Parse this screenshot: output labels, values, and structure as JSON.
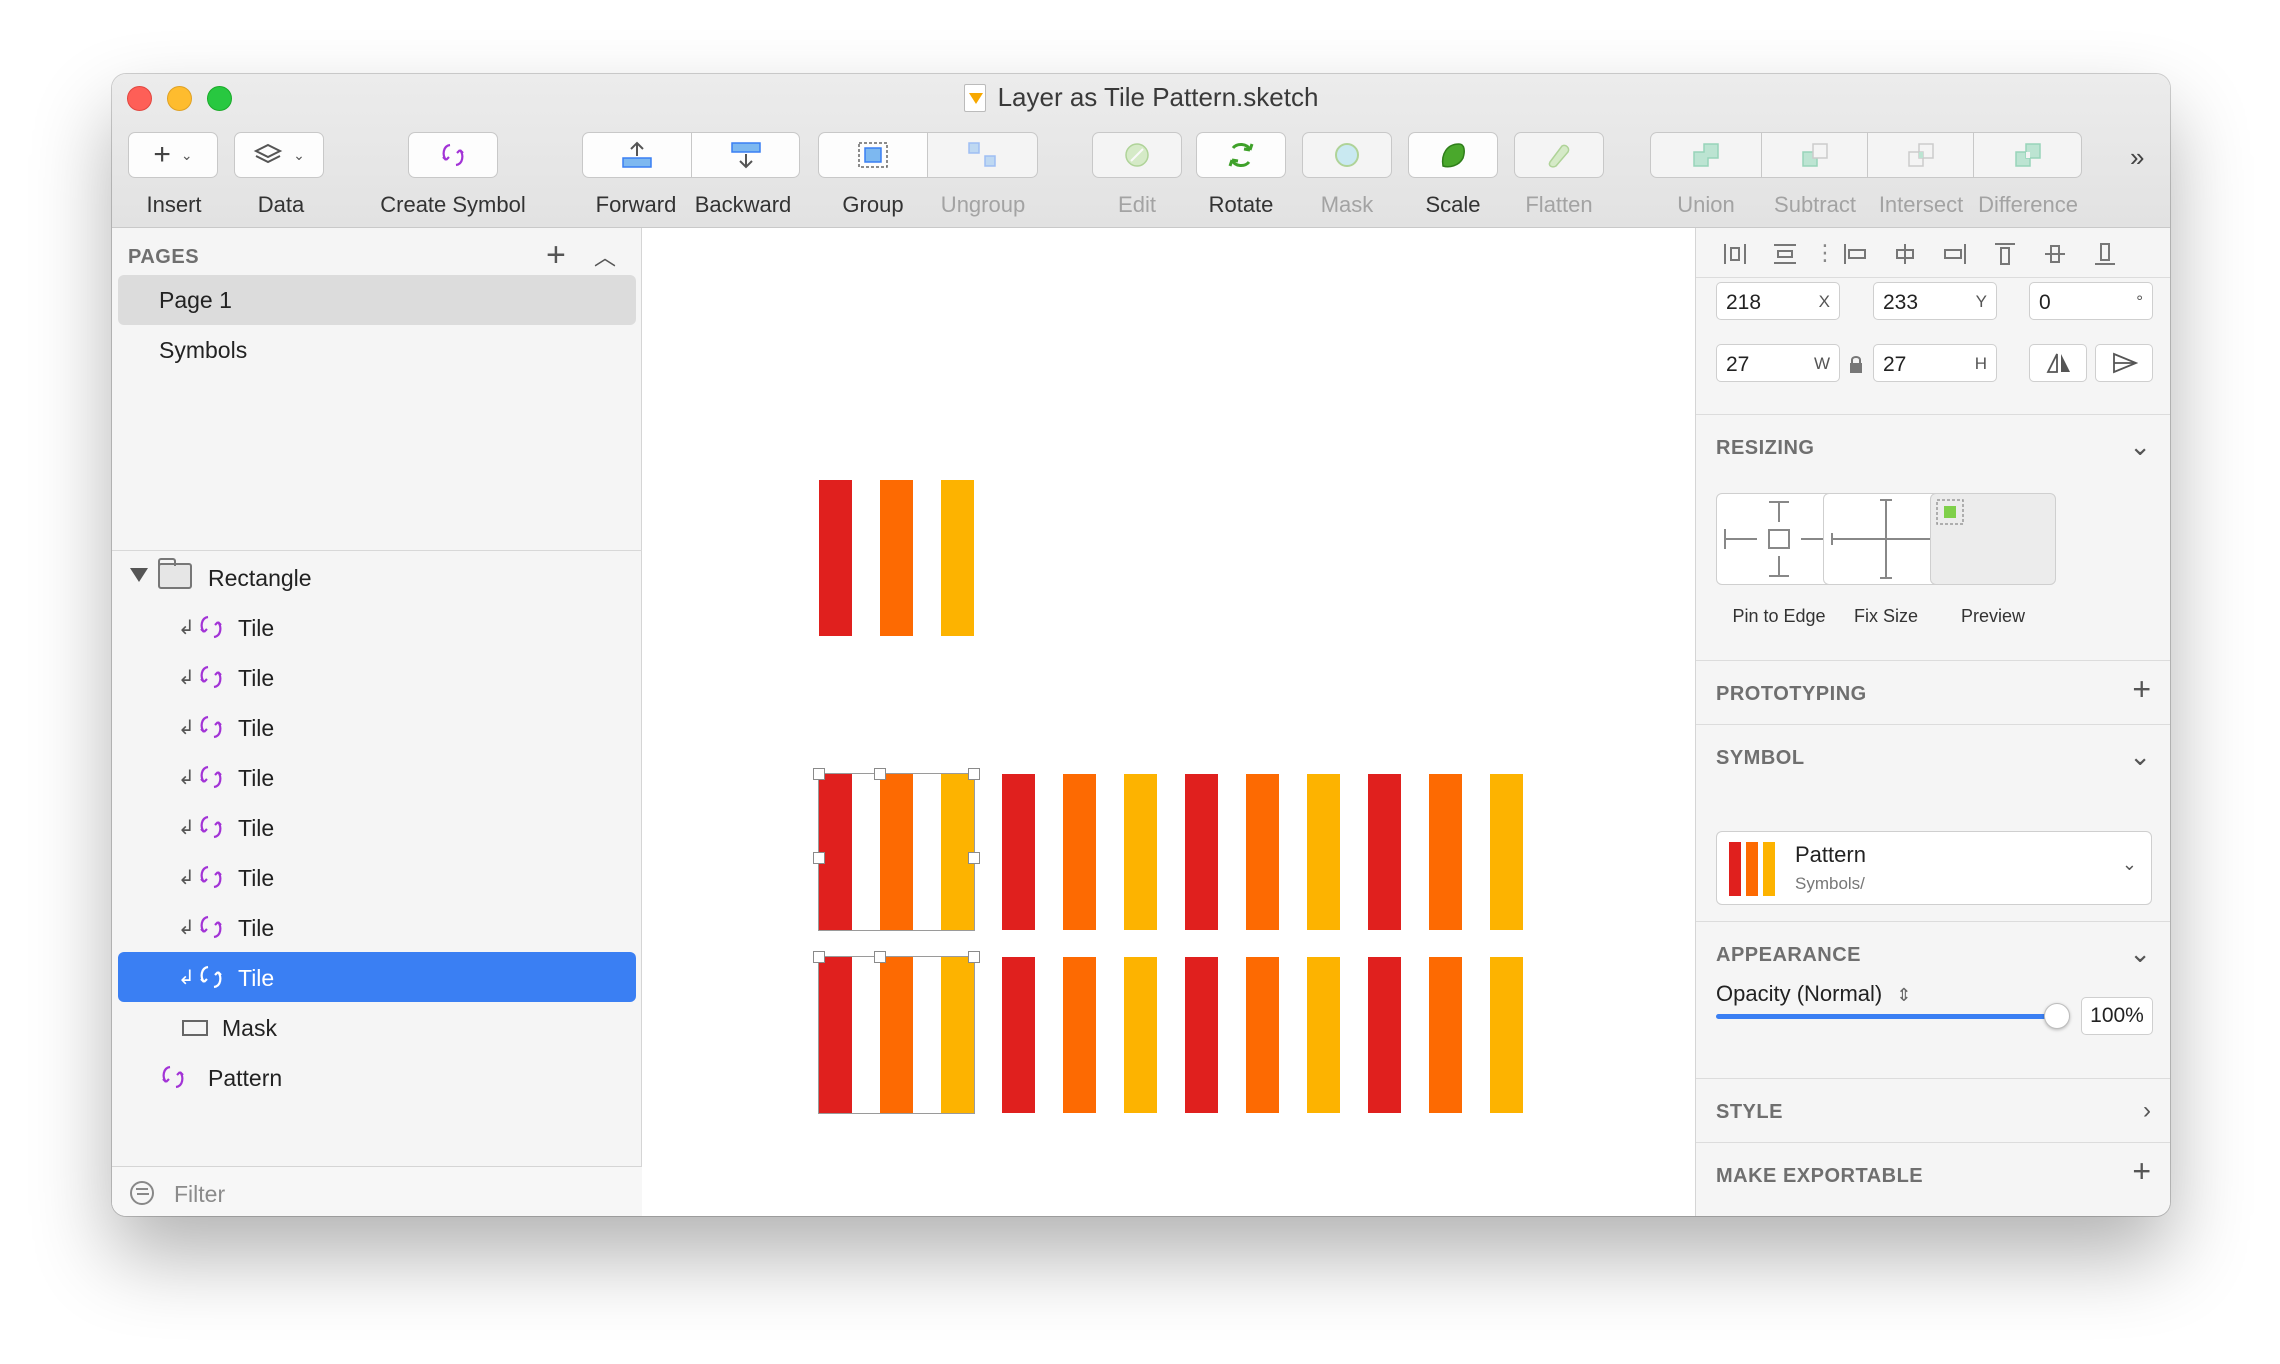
{
  "window": {
    "title": "Layer as Tile Pattern.sketch"
  },
  "toolbar": {
    "insert": "Insert",
    "data": "Data",
    "create_symbol": "Create Symbol",
    "forward": "Forward",
    "backward": "Backward",
    "group": "Group",
    "ungroup": "Ungroup",
    "edit": "Edit",
    "rotate": "Rotate",
    "mask": "Mask",
    "scale": "Scale",
    "flatten": "Flatten",
    "union": "Union",
    "subtract": "Subtract",
    "intersect": "Intersect",
    "difference": "Difference"
  },
  "pages": {
    "title": "PAGES",
    "items": [
      {
        "label": "Page 1",
        "selected": true
      },
      {
        "label": "Symbols",
        "selected": false
      }
    ]
  },
  "layers": {
    "group": "Rectangle",
    "tiles": [
      "Tile",
      "Tile",
      "Tile",
      "Tile",
      "Tile",
      "Tile",
      "Tile",
      "Tile"
    ],
    "selected_tile": 7,
    "mask": "Mask",
    "pattern": "Pattern"
  },
  "filter": {
    "placeholder": "Filter"
  },
  "canvas": {
    "colors": [
      "#e0201e",
      "#fd6a02",
      "#fdb300"
    ]
  },
  "inspector": {
    "x": "218",
    "x_unit": "X",
    "y": "233",
    "y_unit": "Y",
    "rotation": "0",
    "rotation_unit": "°",
    "w": "27",
    "w_unit": "W",
    "h": "27",
    "h_unit": "H",
    "resizing": {
      "title": "RESIZING",
      "pin_to_edge": "Pin to Edge",
      "fix_size": "Fix Size",
      "preview": "Preview"
    },
    "prototyping": "PROTOTYPING",
    "symbol": {
      "title": "SYMBOL",
      "name": "Pattern",
      "path": "Symbols/"
    },
    "appearance": {
      "title": "APPEARANCE",
      "opacity_label": "Opacity (Normal)",
      "opacity_value": "100%"
    },
    "style": "STYLE",
    "make_exportable": "MAKE EXPORTABLE"
  },
  "colors": {
    "selection_blue": "#3a7ff3",
    "symbol_purple": "#a233d6"
  }
}
